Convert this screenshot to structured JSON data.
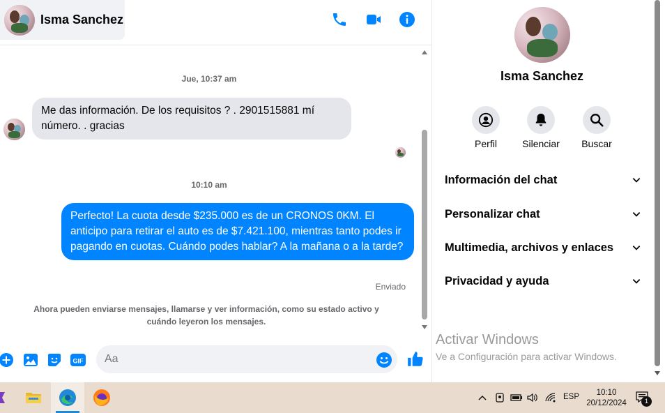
{
  "header": {
    "contact_name": "Isma Sanchez",
    "icons": [
      "phone-icon",
      "video-icon",
      "info-icon"
    ],
    "accent_color": "#0084ff"
  },
  "messages": {
    "timestamp_1": "Jue, 10:37 am",
    "incoming_text": "Me das información. De los requisitos ?  .  2901515881 mí número. .    gracias",
    "timestamp_2": "10:10 am",
    "outgoing_text": "Perfecto! La cuota desde $235.000 es de un CRONOS 0KM. El anticipo para retirar el auto es de $7.421.100, mientras tanto podes ir pagando en cuotas. Cuándo podes hablar? A la mañana o a la tarde?",
    "status": "Enviado",
    "system_note": "Ahora pueden enviarse mensajes, llamarse y ver información, como su estado activo y cuándo leyeron los mensajes."
  },
  "composer": {
    "placeholder": "Aa",
    "icons": [
      "plus-icon",
      "image-icon",
      "sticker-icon",
      "gif-icon",
      "emoji-icon",
      "like-icon"
    ],
    "gif_label": "GIF"
  },
  "panel": {
    "name": "Isma Sanchez",
    "actions": [
      {
        "label": "Perfil",
        "icon": "profile-icon"
      },
      {
        "label": "Silenciar",
        "icon": "bell-icon"
      },
      {
        "label": "Buscar",
        "icon": "search-icon"
      }
    ],
    "sections": [
      {
        "label": "Información del chat"
      },
      {
        "label": "Personalizar chat"
      },
      {
        "label": "Multimedia, archivos y enlaces"
      },
      {
        "label": "Privacidad y ayuda"
      }
    ]
  },
  "activation": {
    "title": "Activar Windows",
    "subtitle": "Ve a Configuración para activar Windows."
  },
  "taskbar": {
    "apps": [
      "app-icon",
      "file-explorer-icon",
      "edge-icon",
      "firefox-icon"
    ],
    "language": "ESP",
    "time": "10:10",
    "date": "20/12/2024",
    "notification_count": "1"
  }
}
